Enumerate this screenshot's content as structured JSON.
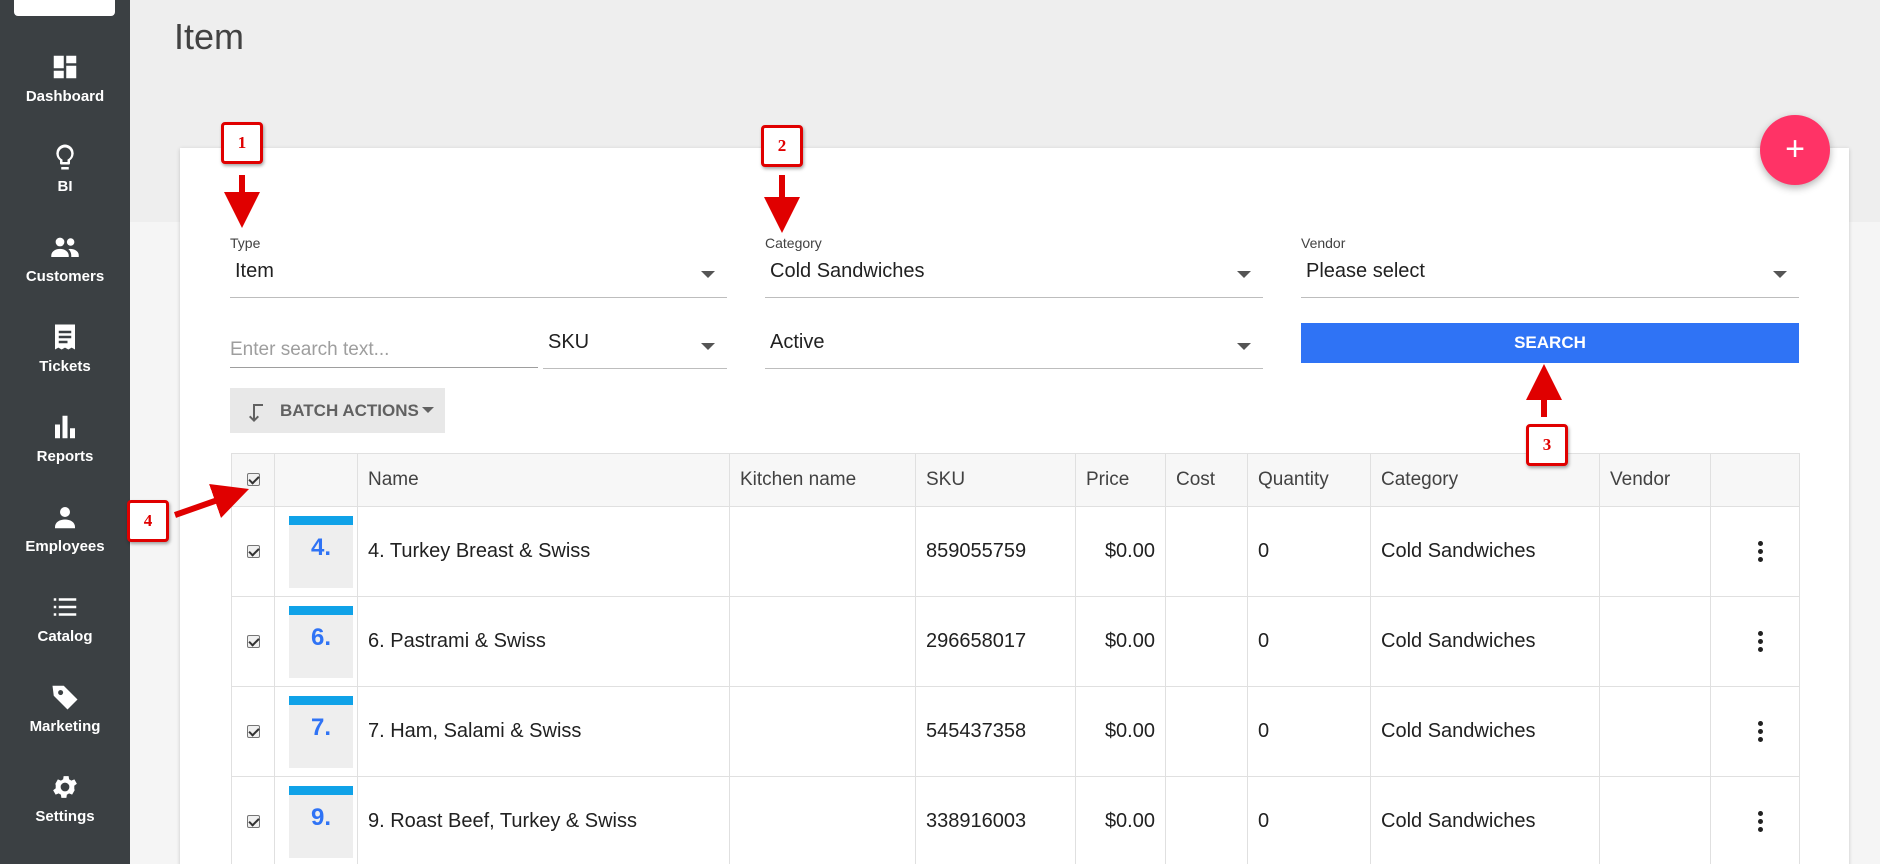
{
  "sidebar": {
    "items": [
      {
        "label": "Dashboard",
        "icon": "dashboard-icon"
      },
      {
        "label": "BI",
        "icon": "lightbulb-icon"
      },
      {
        "label": "Customers",
        "icon": "people-icon"
      },
      {
        "label": "Tickets",
        "icon": "receipt-icon"
      },
      {
        "label": "Reports",
        "icon": "bar-chart-icon"
      },
      {
        "label": "Employees",
        "icon": "person-icon"
      },
      {
        "label": "Catalog",
        "icon": "list-icon"
      },
      {
        "label": "Marketing",
        "icon": "tag-icon"
      },
      {
        "label": "Settings",
        "icon": "gear-icon"
      }
    ]
  },
  "page": {
    "title": "Item",
    "fab_label": "+"
  },
  "filters": {
    "type": {
      "label": "Type",
      "value": "Item"
    },
    "category": {
      "label": "Category",
      "value": "Cold Sandwiches"
    },
    "vendor": {
      "label": "Vendor",
      "value": "Please select"
    },
    "search": {
      "placeholder": "Enter search text...",
      "value": ""
    },
    "search_field": {
      "value": "SKU"
    },
    "status": {
      "value": "Active"
    },
    "search_button": "SEARCH",
    "batch_actions": "BATCH ACTIONS"
  },
  "table": {
    "columns": [
      "",
      "",
      "Name",
      "Kitchen name",
      "SKU",
      "Price",
      "Cost",
      "Quantity",
      "Category",
      "Vendor",
      ""
    ],
    "rows": [
      {
        "thumb": "4.",
        "name": "4. Turkey Breast & Swiss",
        "kitchen_name": "",
        "sku": "859055759",
        "price": "$0.00",
        "cost": "",
        "quantity": "0",
        "category": "Cold Sandwiches",
        "vendor": ""
      },
      {
        "thumb": "6.",
        "name": "6. Pastrami & Swiss",
        "kitchen_name": "",
        "sku": "296658017",
        "price": "$0.00",
        "cost": "",
        "quantity": "0",
        "category": "Cold Sandwiches",
        "vendor": ""
      },
      {
        "thumb": "7.",
        "name": "7. Ham, Salami & Swiss",
        "kitchen_name": "",
        "sku": "545437358",
        "price": "$0.00",
        "cost": "",
        "quantity": "0",
        "category": "Cold Sandwiches",
        "vendor": ""
      },
      {
        "thumb": "9.",
        "name": "9. Roast Beef, Turkey & Swiss",
        "kitchen_name": "",
        "sku": "338916003",
        "price": "$0.00",
        "cost": "",
        "quantity": "0",
        "category": "Cold Sandwiches",
        "vendor": ""
      }
    ]
  },
  "annotations": {
    "b1": "1",
    "b2": "2",
    "b3": "3",
    "b4": "4"
  },
  "colors": {
    "accent": "#2f73f5",
    "fab": "#ff3366",
    "sidebar": "#3b4043",
    "annotation": "#e00000",
    "thumb_bar": "#10a2e8"
  }
}
